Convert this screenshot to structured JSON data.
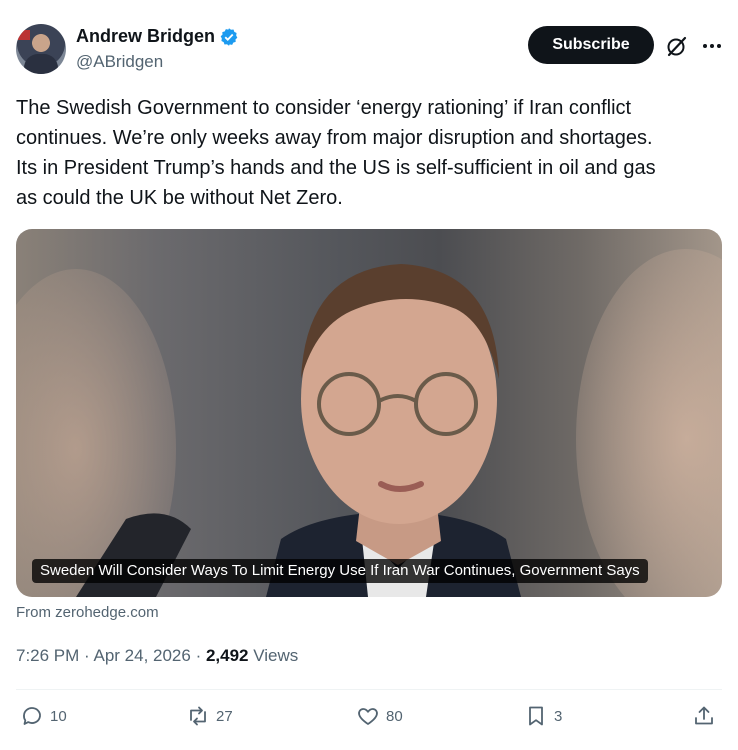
{
  "author": {
    "name": "Andrew Bridgen",
    "handle": "@ABridgen",
    "verified": true
  },
  "header": {
    "subscribe_label": "Subscribe",
    "icons": [
      "grok-icon",
      "more-icon"
    ]
  },
  "tweet": {
    "lines": [
      "The Swedish Government to consider ‘energy rationing’ if Iran conflict",
      "continues.  We’re only weeks away from major disruption and shortages.",
      "Its in President Trump’s hands and the US is self-sufficient in oil and gas",
      "as could the UK be without Net Zero."
    ]
  },
  "media": {
    "caption": "Sweden Will Consider Ways To Limit Energy Use If Iran War Continues, Government Says",
    "source": "From zerohedge.com"
  },
  "meta": {
    "time": "7:26 PM",
    "sep1": " · ",
    "date": "Apr 24, 2026",
    "sep2": " · ",
    "views_count": "2,492",
    "views_label": " Views"
  },
  "actions": {
    "replies": "10",
    "reposts": "27",
    "likes": "80",
    "bookmarks": "3"
  },
  "colors": {
    "text": "#0f1419",
    "secondary": "#536471",
    "verified": "#1d9bf0",
    "divider": "#eff3f4"
  }
}
